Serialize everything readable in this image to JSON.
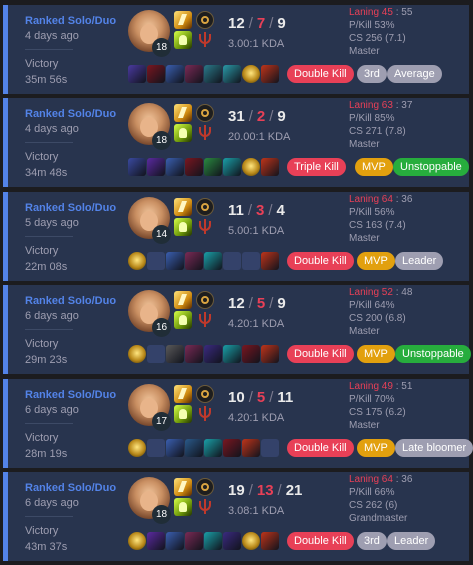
{
  "matches": [
    {
      "queue": "Ranked Solo/Duo",
      "ago": "4 days ago",
      "result": "Victory",
      "duration": "35m 56s",
      "level": "18",
      "kills": "12",
      "deaths": "7",
      "assists": "9",
      "kda_ratio": "3.00:1 KDA",
      "laning_label": "Laning 45",
      "laning_opp": "55",
      "pkill": "P/Kill 53%",
      "cs": "CS 256 (7.1)",
      "tier": "Master",
      "items": [
        "#4a3aa0",
        "#7a1620",
        "#3a5fb0",
        "#7a2a55",
        "#2a7a8a",
        "#2a9aa8",
        "ward",
        "#c0341a"
      ],
      "badges": [
        {
          "label": "Double Kill",
          "color": "red"
        },
        {
          "label": "3rd",
          "color": "gray"
        },
        {
          "label": "Average",
          "color": "gray"
        }
      ]
    },
    {
      "queue": "Ranked Solo/Duo",
      "ago": "4 days ago",
      "result": "Victory",
      "duration": "34m 48s",
      "level": "18",
      "kills": "31",
      "deaths": "2",
      "assists": "9",
      "kda_ratio": "20.00:1 KDA",
      "laning_label": "Laning 63",
      "laning_opp": "37",
      "pkill": "P/Kill 85%",
      "cs": "CS 271 (7.8)",
      "tier": "Master",
      "items": [
        "#3a4aa0",
        "#5a2aa0",
        "#3a5fb0",
        "#7a1620",
        "#2a8a40",
        "#1aa0a8",
        "ward",
        "#c0341a"
      ],
      "badges": [
        {
          "label": "Triple Kill",
          "color": "red"
        },
        {
          "label": "MVP",
          "color": "gold"
        },
        {
          "label": "Unstoppable",
          "color": "green"
        }
      ]
    },
    {
      "queue": "Ranked Solo/Duo",
      "ago": "5 days ago",
      "result": "Victory",
      "duration": "22m 08s",
      "level": "14",
      "kills": "11",
      "deaths": "3",
      "assists": "4",
      "kda_ratio": "5.00:1 KDA",
      "laning_label": "Laning 64",
      "laning_opp": "36",
      "pkill": "P/Kill 56%",
      "cs": "CS 163 (7.4)",
      "tier": "Master",
      "items": [
        "ward",
        "empty",
        "#3a5fb0",
        "#7a2a55",
        "#1aa0a8",
        "empty",
        "empty",
        "#c0341a"
      ],
      "badges": [
        {
          "label": "Double Kill",
          "color": "red"
        },
        {
          "label": "MVP",
          "color": "gold"
        },
        {
          "label": "Leader",
          "color": "gray"
        }
      ]
    },
    {
      "queue": "Ranked Solo/Duo",
      "ago": "6 days ago",
      "result": "Victory",
      "duration": "29m 23s",
      "level": "16",
      "kills": "12",
      "deaths": "5",
      "assists": "9",
      "kda_ratio": "4.20:1 KDA",
      "laning_label": "Laning 52",
      "laning_opp": "48",
      "pkill": "P/Kill 64%",
      "cs": "CS 200 (6.8)",
      "tier": "Master",
      "items": [
        "ward",
        "empty",
        "#5a5a5a",
        "#7a2a55",
        "#3a2a80",
        "#1aa0a8",
        "#7a1620",
        "#c0341a"
      ],
      "badges": [
        {
          "label": "Double Kill",
          "color": "red"
        },
        {
          "label": "MVP",
          "color": "gold"
        },
        {
          "label": "Unstoppable",
          "color": "green"
        }
      ]
    },
    {
      "queue": "Ranked Solo/Duo",
      "ago": "6 days ago",
      "result": "Victory",
      "duration": "28m 19s",
      "level": "17",
      "kills": "10",
      "deaths": "5",
      "assists": "11",
      "kda_ratio": "4.20:1 KDA",
      "laning_label": "Laning 49",
      "laning_opp": "51",
      "pkill": "P/Kill 70%",
      "cs": "CS 175 (6.2)",
      "tier": "Master",
      "items": [
        "ward",
        "empty",
        "#3a5fb0",
        "#2a5a8a",
        "#1aa0a8",
        "#7a1620",
        "#c0341a",
        "empty"
      ],
      "badges": [
        {
          "label": "Double Kill",
          "color": "red"
        },
        {
          "label": "MVP",
          "color": "gold"
        },
        {
          "label": "Late bloomer",
          "color": "gray"
        }
      ]
    },
    {
      "queue": "Ranked Solo/Duo",
      "ago": "6 days ago",
      "result": "Victory",
      "duration": "43m 37s",
      "level": "18",
      "kills": "19",
      "deaths": "13",
      "assists": "21",
      "kda_ratio": "3.08:1 KDA",
      "laning_label": "Laning 64",
      "laning_opp": "36",
      "pkill": "P/Kill 66%",
      "cs": "CS 262 (6)",
      "tier": "Grandmaster",
      "items": [
        "ward",
        "#5a2aa0",
        "#3a5fb0",
        "#7a2a55",
        "#1aa0a8",
        "#3a2a80",
        "ward",
        "#c0341a"
      ],
      "badges": [
        {
          "label": "Double Kill",
          "color": "red"
        },
        {
          "label": "3rd",
          "color": "gray"
        },
        {
          "label": "Leader",
          "color": "gray"
        }
      ]
    }
  ]
}
